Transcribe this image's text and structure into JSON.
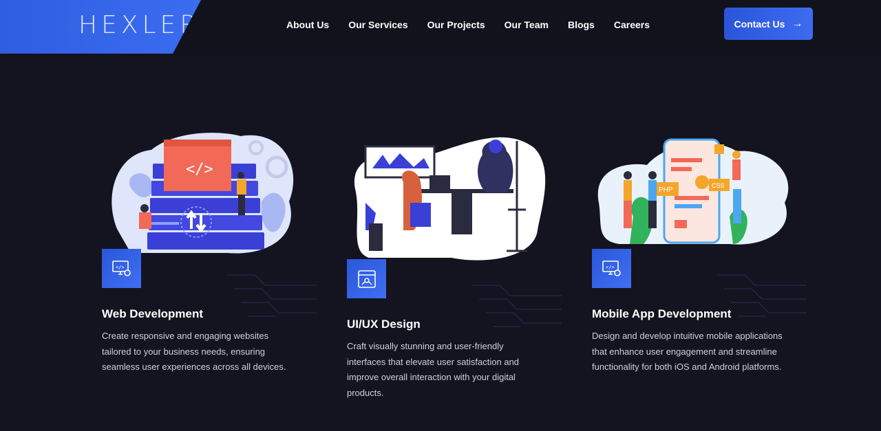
{
  "header": {
    "logo": "HEXLER",
    "nav": [
      "About Us",
      "Our Services",
      "Our Projects",
      "Our Team",
      "Blogs",
      "Careers"
    ],
    "contact_label": "Contact Us"
  },
  "cards": [
    {
      "title": "Web Development",
      "description": "Create responsive and engaging websites tailored to your business needs, ensuring seamless user experiences across all devices.",
      "icon": "monitor-code-gear-icon"
    },
    {
      "title": "UI/UX Design",
      "description": "Craft visually stunning and user-friendly interfaces that elevate user satisfaction and improve overall interaction with your digital products.",
      "icon": "design-layout-icon"
    },
    {
      "title": "Mobile App Development",
      "description": "Design and develop intuitive mobile applications that enhance user engagement and streamline functionality for both iOS and Android platforms.",
      "icon": "monitor-code-gear-icon"
    }
  ],
  "colors": {
    "background": "#13131f",
    "accent": "#3b6cf0"
  }
}
